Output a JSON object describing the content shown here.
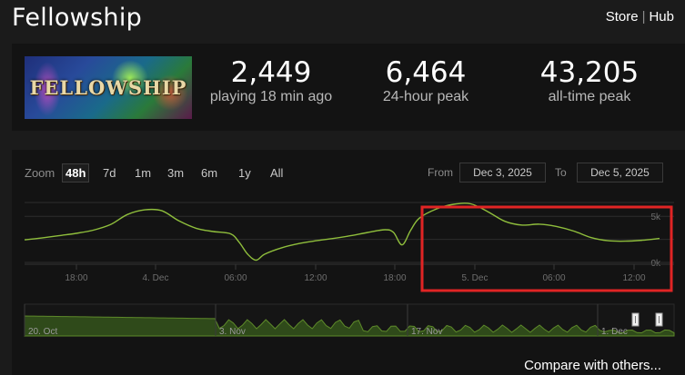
{
  "header": {
    "title": "Fellowship",
    "links": [
      "Store",
      "Hub"
    ],
    "separator": "|"
  },
  "game": {
    "logo_text": "FELLOWSHIP"
  },
  "stats": [
    {
      "value": "2,449",
      "label": "playing 18 min ago"
    },
    {
      "value": "6,464",
      "label": "24-hour peak"
    },
    {
      "value": "43,205",
      "label": "all-time peak"
    }
  ],
  "chart": {
    "zoom_label": "Zoom",
    "zoom_options": [
      "48h",
      "7d",
      "1m",
      "3m",
      "6m",
      "1y",
      "All"
    ],
    "zoom_selected": "48h",
    "from_label": "From",
    "from_value": "Dec 3, 2025",
    "to_label": "To",
    "to_value": "Dec 5, 2025",
    "compare_link": "Compare with others...",
    "colors": {
      "line": "#8fbe3c",
      "navigator_fill": "#2f4a1a",
      "highlight": "#e02424",
      "grid": "#2d2d2d"
    }
  },
  "chart_data": {
    "type": "line",
    "title": "",
    "xlabel": "",
    "ylabel": "",
    "x_ticks": [
      "18:00",
      "4. Dec",
      "06:00",
      "12:00",
      "18:00",
      "5. Dec",
      "06:00",
      "12:00"
    ],
    "y_ticks": [
      "0k",
      "5k"
    ],
    "ylim": [
      0,
      6500
    ],
    "grid": true,
    "series": [
      {
        "x": [
          0,
          2,
          4,
          6,
          8,
          10,
          12,
          14,
          16,
          18,
          20,
          22,
          24,
          25,
          26,
          27,
          28,
          30,
          32,
          34,
          36,
          38,
          40,
          42,
          43,
          44,
          45,
          46,
          48,
          50,
          52,
          54,
          56,
          58,
          60,
          62,
          64,
          66,
          68,
          70,
          72,
          74
        ],
        "values": [
          2450,
          2650,
          2900,
          3150,
          3500,
          4100,
          5200,
          5700,
          5600,
          4500,
          3700,
          3350,
          3100,
          2200,
          900,
          250,
          900,
          1600,
          2050,
          2350,
          2600,
          2900,
          3250,
          3550,
          3250,
          1900,
          3500,
          4800,
          5800,
          6300,
          6350,
          5500,
          4450,
          4050,
          4150,
          3900,
          3400,
          2700,
          2350,
          2300,
          2400,
          2600
        ]
      }
    ],
    "navigator": {
      "x_labels": [
        "20. Oct",
        "3. Nov",
        "17. Nov",
        "1. Dec"
      ]
    }
  }
}
